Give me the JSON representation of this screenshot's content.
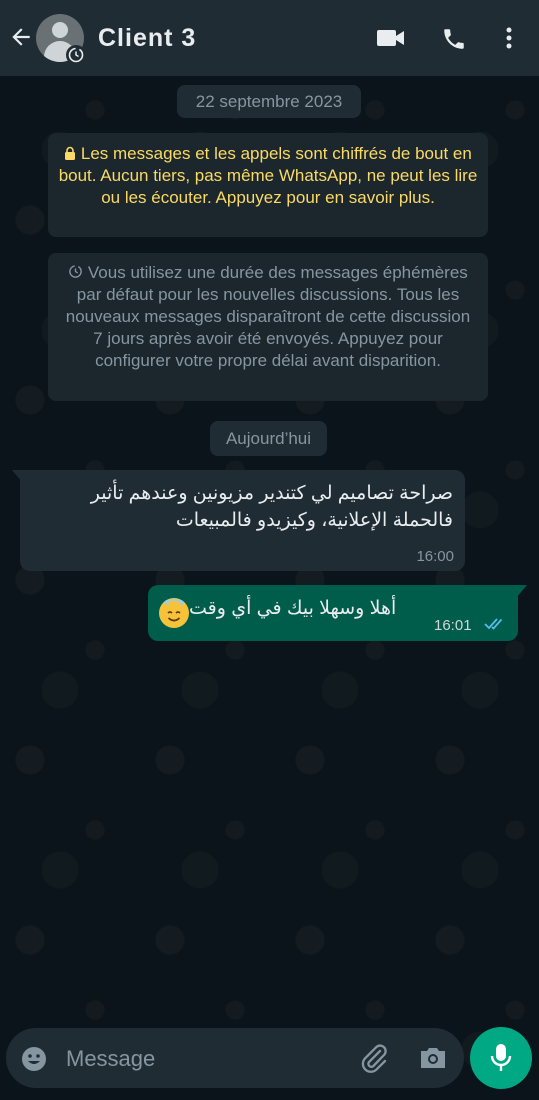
{
  "header": {
    "title": "Client 3",
    "icons": [
      "back-arrow-icon",
      "avatar-icon",
      "disappearing-timer-icon",
      "video-call-icon",
      "phone-call-icon",
      "more-options-icon"
    ]
  },
  "chat": {
    "date_separator": "22 septembre 2023",
    "encryption_notice": "Les messages et les appels sont chiffrés de bout en bout. Aucun tiers, pas même WhatsApp, ne peut les lire ou les écouter. Appuyez pour en savoir plus.",
    "ephemeral_notice": "Vous utilisez une durée des messages éphémères par défaut pour les nouvelles discussions. Tous les nouveaux messages disparaîtront de cette discussion 7 jours après avoir été envoyés. Appuyez pour configurer votre propre délai avant disparition.",
    "today_separator": "Aujourd’hui",
    "messages": [
      {
        "direction": "incoming",
        "text": "صراحة تصاميم لي كتندير مزيونين وعندهم تأثير فالحملة الإعلانية، وكيزيدو فالمبيعات",
        "time": "16:00"
      },
      {
        "direction": "outgoing",
        "text": "أهلا وسهلا بيك في أي وقت",
        "time": "16:01",
        "status": "read"
      }
    ]
  },
  "composer": {
    "placeholder": "Message",
    "icons": [
      "emoji-icon",
      "attach-icon",
      "camera-icon",
      "mic-icon"
    ]
  },
  "colors": {
    "header_bg": "#1f2c34",
    "chat_bg": "#0b141a",
    "outgoing_bubble": "#005c4b",
    "incoming_bubble": "#1f2c34",
    "accent": "#00a884",
    "notice_yellow": "#fad964",
    "read_ticks": "#53bdeb"
  }
}
